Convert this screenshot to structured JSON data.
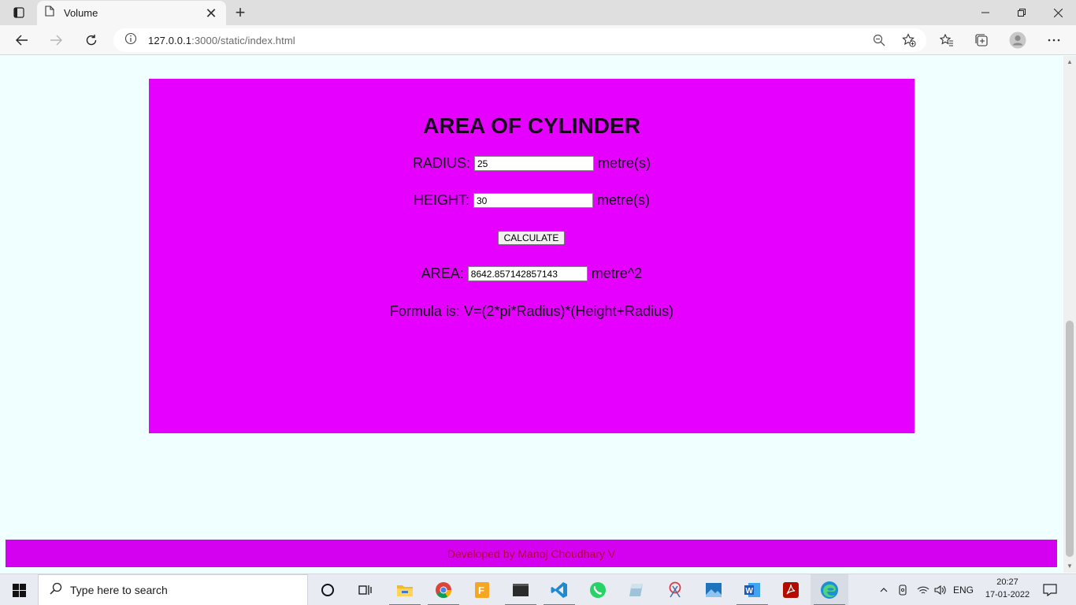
{
  "browser": {
    "tab_title": "Volume",
    "url_host": "127.0.0.1",
    "url_rest": ":3000/static/index.html"
  },
  "page": {
    "heading": "AREA OF CYLINDER",
    "radius": {
      "label": "RADIUS:",
      "value": "25",
      "unit": "metre(s)"
    },
    "height": {
      "label": "HEIGHT:",
      "value": "30",
      "unit": "metre(s)"
    },
    "calculate_label": "CALCULATE",
    "area": {
      "label": "AREA:",
      "value": "8642.857142857143",
      "unit": "metre^2"
    },
    "formula": "Formula is: V=(2*pi*Radius)*(Height+Radius)",
    "footer": "Developed by Manoj Choudhary V"
  },
  "taskbar": {
    "search_placeholder": "Type here to search",
    "language": "ENG",
    "time": "20:27",
    "date": "17-01-2022"
  },
  "colors": {
    "card_bg": "#e600ff",
    "footer_bg": "#d400f0",
    "footer_text": "#b00030",
    "page_bg": "#f0ffff"
  }
}
